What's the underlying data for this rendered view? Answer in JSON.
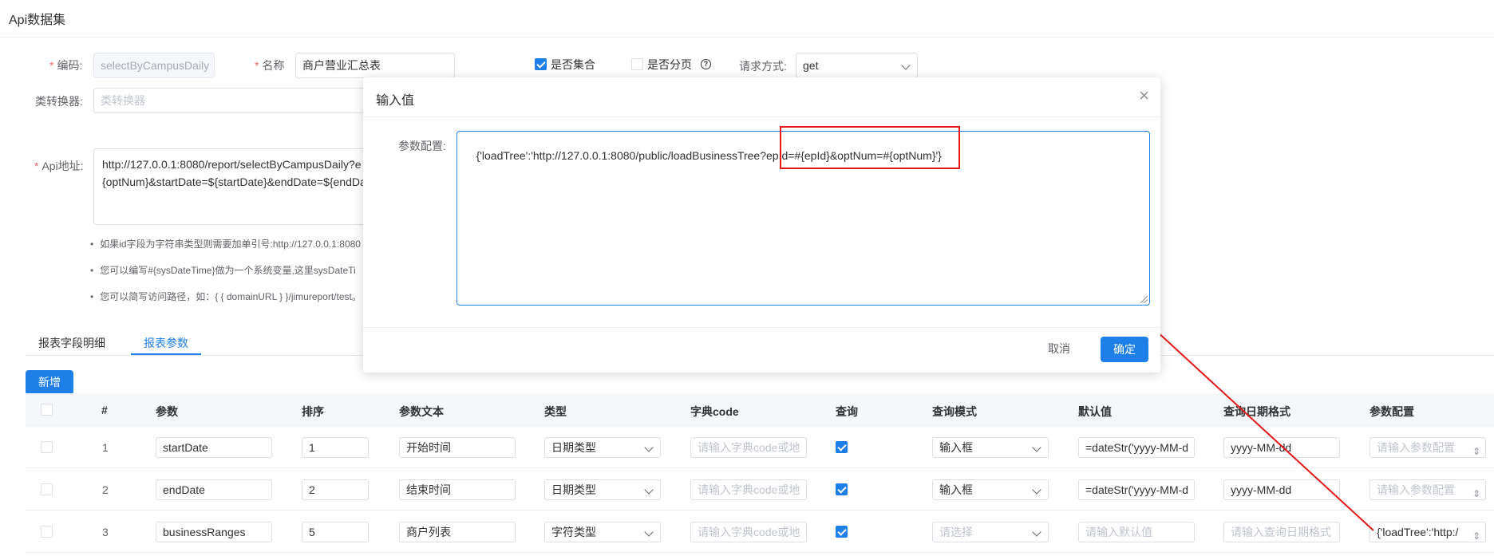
{
  "page": {
    "title": "Api数据集"
  },
  "form": {
    "code_label": "编码:",
    "code_value": "selectByCampusDaily",
    "name_label": "名称",
    "name_value": "商户营业汇总表",
    "is_collection_label": "是否集合",
    "is_collection_checked": true,
    "is_paged_label": "是否分页",
    "is_paged_checked": false,
    "help_glyph": "?",
    "method_label": "请求方式:",
    "method_value": "get",
    "converter_label": "类转换器:",
    "converter_placeholder": "类转换器",
    "api_label": "Api地址:",
    "api_value": "http://127.0.0.1:8080/report/selectByCampusDaily?e\n{optNum}&startDate=${startDate}&endDate=${endDa",
    "tips": [
      "如果id字段为字符串类型则需要加单引号:http://127.0.0.1:8080",
      "您可以编写#{sysDateTime}做为一个系统变量,这里sysDateTi",
      "您可以简写访问路径，如：{ { domainURL } }/jimureport/test。"
    ]
  },
  "tabs": [
    {
      "label": "报表字段明细",
      "active": false
    },
    {
      "label": "报表参数",
      "active": true
    }
  ],
  "add_button": "新增",
  "table": {
    "headers": [
      "#",
      "参数",
      "排序",
      "参数文本",
      "类型",
      "字典code",
      "查询",
      "查询模式",
      "默认值",
      "查询日期格式",
      "参数配置"
    ],
    "rows": [
      {
        "num": "1",
        "param": "startDate",
        "order": "1",
        "text": "开始时间",
        "type": "日期类型",
        "dict_placeholder": "请输入字典code或地",
        "query": true,
        "mode": "输入框",
        "mode_is_placeholder": false,
        "default": "=dateStr('yyyy-MM-d",
        "default_is_placeholder": false,
        "date_fmt": "yyyy-MM-dd",
        "date_fmt_is_placeholder": false,
        "config": "请输入参数配置",
        "config_is_placeholder": true
      },
      {
        "num": "2",
        "param": "endDate",
        "order": "2",
        "text": "结束时间",
        "type": "日期类型",
        "dict_placeholder": "请输入字典code或地",
        "query": true,
        "mode": "输入框",
        "mode_is_placeholder": false,
        "default": "=dateStr('yyyy-MM-d",
        "default_is_placeholder": false,
        "date_fmt": "yyyy-MM-dd",
        "date_fmt_is_placeholder": false,
        "config": "请输入参数配置",
        "config_is_placeholder": true
      },
      {
        "num": "3",
        "param": "businessRanges",
        "order": "5",
        "text": "商户列表",
        "type": "字符类型",
        "dict_placeholder": "请输入字典code或地",
        "query": true,
        "mode": "请选择",
        "mode_is_placeholder": true,
        "default": "请输入默认值",
        "default_is_placeholder": true,
        "date_fmt": "请输入查询日期格式",
        "date_fmt_is_placeholder": true,
        "config": "{'loadTree':'http:/",
        "config_is_placeholder": false
      }
    ]
  },
  "modal": {
    "title": "输入值",
    "close_glyph": "×",
    "param_label": "参数配置:",
    "param_value": "{'loadTree':'http://127.0.0.1:8080/public/loadBusinessTree?epId=#{epId}&optNum=#{optNum}'}",
    "cancel_label": "取消",
    "ok_label": "确定"
  },
  "colors": {
    "accent": "#1e7fe8",
    "annotation": "#e21818",
    "required": "#f56c6c"
  }
}
